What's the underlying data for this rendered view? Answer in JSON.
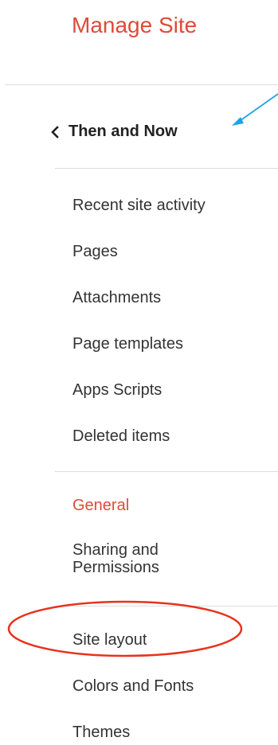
{
  "header": {
    "title": "Manage Site"
  },
  "site": {
    "name": "Then and Now",
    "back_icon": "chevron-left-icon"
  },
  "nav": {
    "recent_activity": "Recent site activity",
    "pages": "Pages",
    "attachments": "Attachments",
    "page_templates": "Page templates",
    "apps_scripts": "Apps Scripts",
    "deleted_items": "Deleted items",
    "general": "General",
    "sharing_line1": "Sharing and",
    "sharing_line2": "Permissions",
    "site_layout": "Site layout",
    "colors_fonts": "Colors and Fonts",
    "themes": "Themes"
  },
  "colors": {
    "accent": "#dd4b39",
    "annotation_arrow": "#1fa3e0",
    "annotation_circle": "#e8321e"
  }
}
